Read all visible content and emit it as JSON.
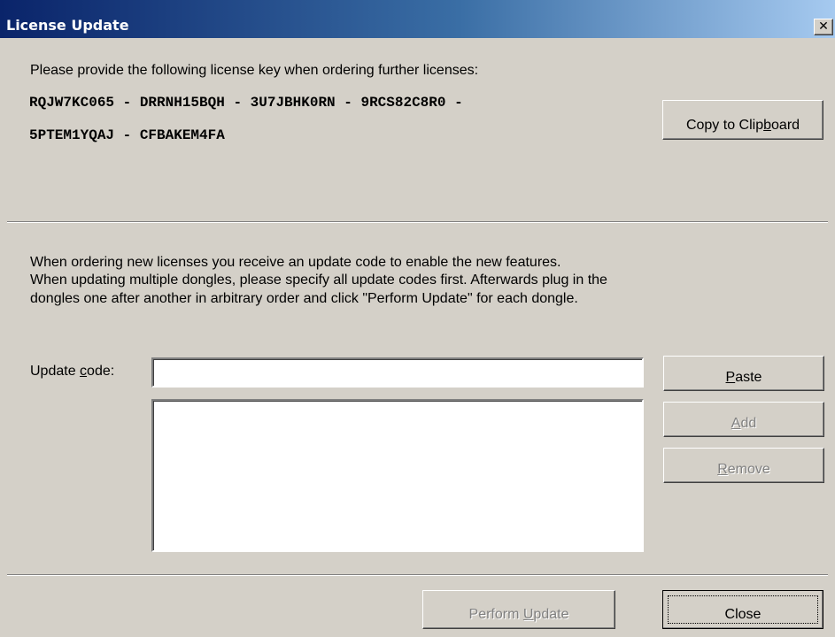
{
  "window": {
    "title": "License Update",
    "close_glyph": "✕"
  },
  "license": {
    "prompt": "Please provide the following license key when ordering further licenses:",
    "key_line1": "RQJW7KC065 - DRRNH15BQH - 3U7JBHK0RN - 9RCS82C8R0 -",
    "key_line2": "5PTEM1YQAJ - CFBAKEM4FA",
    "copy_button": {
      "pre": "Copy to Clip",
      "accel": "b",
      "post": "oard"
    }
  },
  "instructions": [
    "When ordering new licenses you receive an update code to enable the new features.",
    "When updating multiple dongles, please specify all update codes first. Afterwards plug in the",
    "dongles one after another in arbitrary order and click \"Perform Update\" for each dongle."
  ],
  "update_code": {
    "label_pre": "Update ",
    "label_accel": "c",
    "label_post": "ode:",
    "value": "",
    "placeholder": "",
    "codes": []
  },
  "buttons": {
    "paste": {
      "pre": "",
      "accel": "P",
      "post": "aste",
      "enabled": true
    },
    "add": {
      "pre": "",
      "accel": "A",
      "post": "dd",
      "enabled": false
    },
    "remove": {
      "pre": "",
      "accel": "R",
      "post": "emove",
      "enabled": false
    },
    "perform_update": {
      "pre": "Perform ",
      "accel": "U",
      "post": "pdate",
      "enabled": false
    },
    "close": {
      "label": "Close",
      "enabled": true
    }
  },
  "icons": {
    "close": "close-icon"
  },
  "colors": {
    "titlebar_start": "#0a246a",
    "titlebar_end": "#a6caf0",
    "face": "#d4d0c8",
    "disabled_text": "#808080"
  }
}
